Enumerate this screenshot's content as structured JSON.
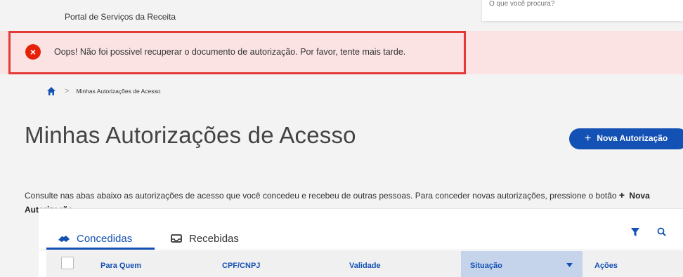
{
  "header": {
    "portal_name": "Portal de Serviços da Receita",
    "search_placeholder": "O que você procura?"
  },
  "alert": {
    "type": "error",
    "icon": "close-icon",
    "message": "Oops! Não foi possivel recuperar o documento de autorização. Por favor, tente mais tarde."
  },
  "breadcrumb": {
    "home_icon": "home-icon",
    "separator": ">",
    "current": "Minhas Autorizações de Acesso"
  },
  "page": {
    "title": "Minhas Autorizações de Acesso",
    "new_button_label": "Nova Autorização",
    "description_part1": "Consulte nas abas abaixo as autorizações de acesso que você concedeu e recebeu de outras pessoas. Para conceder novas autorizações, pressione o botão",
    "description_action": "Nova Autorização",
    "description_end": "."
  },
  "tabs": [
    {
      "label": "Concedidas",
      "icon": "handshake-icon",
      "active": true
    },
    {
      "label": "Recebidas",
      "icon": "inbox-icon",
      "active": false
    }
  ],
  "toolbar": {
    "filter_icon": "filter-icon",
    "search_icon": "search-icon"
  },
  "table": {
    "columns": [
      "Para Quem",
      "CPF/CNPJ",
      "Validade",
      "Situação",
      "Ações"
    ],
    "sorted_column": "Situação"
  },
  "colors": {
    "primary": "#1351b4",
    "alert_bg": "#fbe3e3",
    "alert_icon": "#e52207",
    "highlight_frame": "#e53935"
  }
}
